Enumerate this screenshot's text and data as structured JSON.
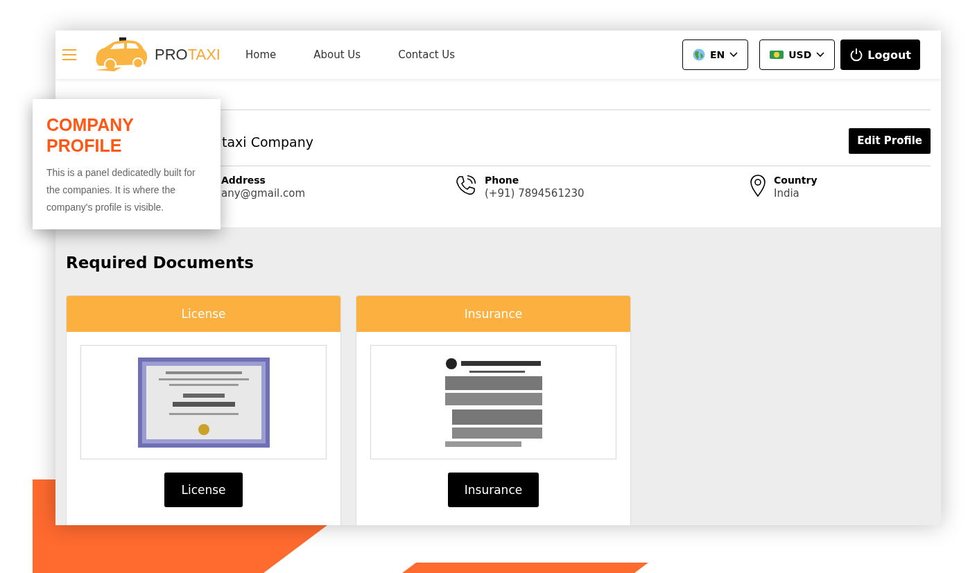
{
  "navbar": {
    "logo": {
      "part_1": "PRO",
      "part_2": "TAXI"
    },
    "links": [
      {
        "label": "Home"
      },
      {
        "label": "About Us"
      },
      {
        "label": "Contact Us"
      }
    ],
    "language": "EN",
    "currency": "USD",
    "logout": "Logout"
  },
  "profile": {
    "company_name": "taxi Company",
    "edit_button": "Edit Profile",
    "details": [
      {
        "kind": "email",
        "label": "Address",
        "value": "any@gmail.com"
      },
      {
        "kind": "phone",
        "label": "Phone",
        "value": "(+91) 7894561230"
      },
      {
        "kind": "location",
        "label": "Country",
        "value": "India"
      }
    ]
  },
  "documents": {
    "title": "Required Documents",
    "cards": [
      {
        "title": "License",
        "button": "License",
        "kind": "certificate"
      },
      {
        "title": "Insurance",
        "button": "Insurance",
        "kind": "letter"
      }
    ]
  },
  "callout": {
    "title": "COMPANY PROFILE",
    "text": "This is a panel dedicatedly built for the companies. It is where the company's profile is visible."
  }
}
